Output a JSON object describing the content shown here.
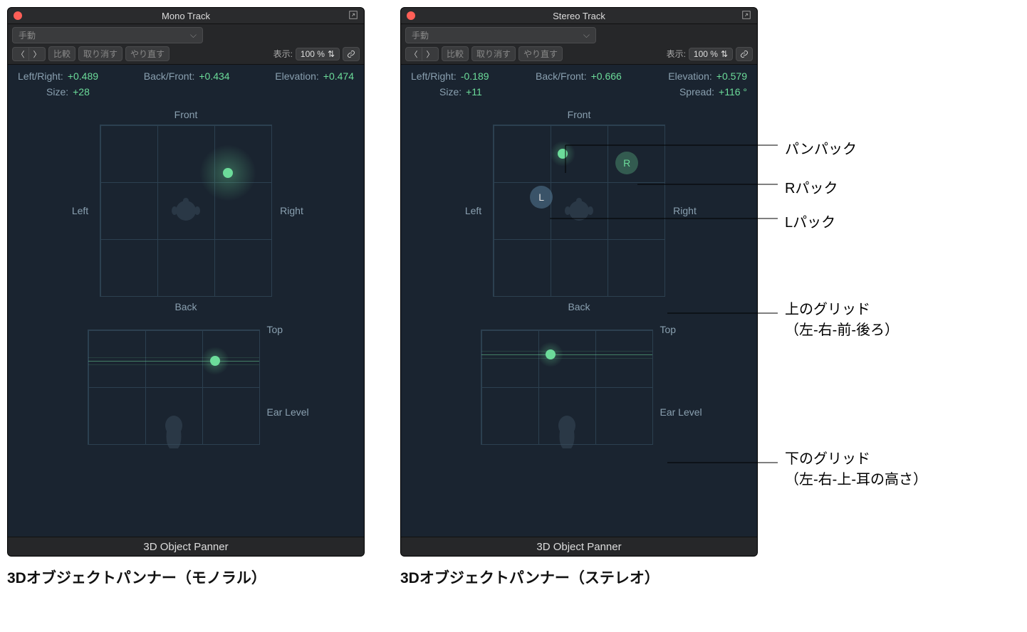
{
  "mono": {
    "title": "Mono Track",
    "mode": "手動",
    "buttons": {
      "compare": "比較",
      "undo": "取り消す",
      "redo": "やり直す"
    },
    "view": {
      "label": "表示:",
      "zoom": "100 %"
    },
    "params": {
      "lr": {
        "label": "Left/Right:",
        "value": "+0.489"
      },
      "bf": {
        "label": "Back/Front:",
        "value": "+0.434"
      },
      "el": {
        "label": "Elevation:",
        "value": "+0.474"
      },
      "size": {
        "label": "Size:",
        "value": "+28"
      }
    },
    "gridlabels": {
      "front": "Front",
      "back": "Back",
      "left": "Left",
      "right": "Right",
      "top": "Top",
      "ear": "Ear Level"
    },
    "footer": "3D Object Panner",
    "caption": "3Dオブジェクトパンナー（モノラル）"
  },
  "stereo": {
    "title": "Stereo Track",
    "mode": "手動",
    "buttons": {
      "compare": "比較",
      "undo": "取り消す",
      "redo": "やり直す"
    },
    "view": {
      "label": "表示:",
      "zoom": "100 %"
    },
    "params": {
      "lr": {
        "label": "Left/Right:",
        "value": "-0.189"
      },
      "bf": {
        "label": "Back/Front:",
        "value": "+0.666"
      },
      "el": {
        "label": "Elevation:",
        "value": "+0.579"
      },
      "size": {
        "label": "Size:",
        "value": "+11"
      },
      "spread": {
        "label": "Spread:",
        "value": "+116 °"
      }
    },
    "gridlabels": {
      "front": "Front",
      "back": "Back",
      "left": "Left",
      "right": "Right",
      "top": "Top",
      "ear": "Ear Level"
    },
    "footer": "3D Object Panner",
    "caption": "3Dオブジェクトパンナー（ステレオ）",
    "lr_letters": {
      "L": "L",
      "R": "R"
    }
  },
  "callouts": {
    "panpuck": "パンパック",
    "rpuck": "Rパック",
    "lpuck": "Lパック",
    "topgrid": "上のグリッド\n（左-右-前-後ろ）",
    "btmgrid": "下のグリッド\n（左-右-上-耳の高さ）"
  }
}
